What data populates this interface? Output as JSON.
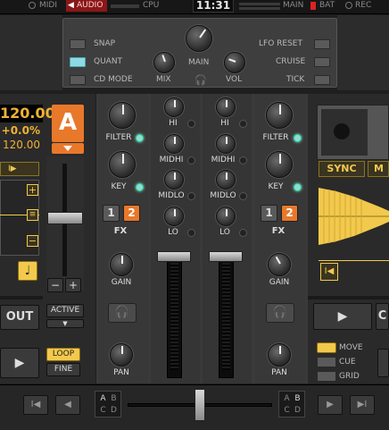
{
  "topbar": {
    "midi_label": "MIDI",
    "audio_label": "AUDIO",
    "cpu_label": "CPU",
    "time": "11:31",
    "main_label": "MAIN",
    "bat_label": "BAT",
    "rec_label": "REC"
  },
  "global": {
    "snap": "SNAP",
    "quant": "QUANT",
    "cd_mode": "CD MODE",
    "main": "MAIN",
    "mix": "MIX",
    "vol": "VOL",
    "lfo_reset": "LFO RESET",
    "cruise": "CRUISE",
    "tick": "TICK",
    "quant_on": true
  },
  "deck_left": {
    "bpm": "120.00",
    "pitch": "+0.0%",
    "tempo": "120.00",
    "letter": "A",
    "play_symbol": "I▶",
    "out_label": "OUT",
    "active_label": "ACTIVE",
    "loop_label": "LOOP",
    "fine_label": "FINE",
    "minus": "−",
    "plus": "+",
    "note_icon": "♩"
  },
  "mixer": {
    "left_channel": {
      "filter": "FILTER",
      "key": "KEY",
      "fx_label": "FX",
      "fx1": "1",
      "fx2": "2",
      "gain": "GAIN",
      "pan": "PAN"
    },
    "eq_left": {
      "hi": "HI",
      "midhi": "MIDHI",
      "midlo": "MIDLO",
      "lo": "LO"
    },
    "eq_right": {
      "hi": "HI",
      "midhi": "MIDHI",
      "midlo": "MIDLO",
      "lo": "LO"
    },
    "right_channel": {
      "filter": "FILTER",
      "key": "KEY",
      "fx_label": "FX",
      "fx1": "1",
      "fx2": "2",
      "gain": "GAIN",
      "pan": "PAN"
    }
  },
  "deck_right": {
    "sync_label": "SYNC",
    "m_label": "M",
    "play_symbol": "▶",
    "c_label": "C",
    "move_label": "MOVE",
    "cue_label": "CUE",
    "grid_label": "GRID"
  },
  "bottom": {
    "btn_prev": "I◀",
    "btn_back": "◀",
    "btn_fwd": "▶",
    "btn_next": "▶I",
    "left_abcd": [
      "A",
      "B",
      "C",
      "D"
    ],
    "right_abcd": [
      "A",
      "B",
      "C",
      "D"
    ]
  },
  "colors": {
    "accent_orange": "#e8782a",
    "accent_cyan": "#8fd9e6",
    "accent_yellow": "#f2c94c"
  }
}
